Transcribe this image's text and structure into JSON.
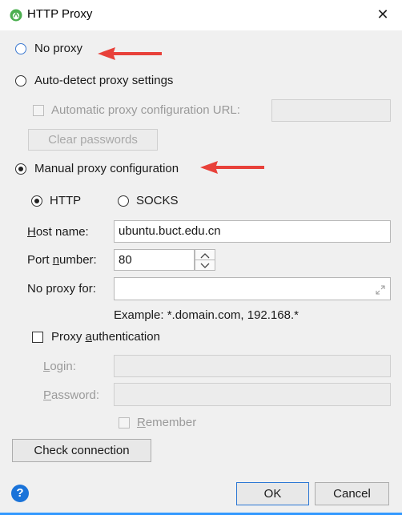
{
  "window": {
    "title": "HTTP Proxy",
    "close_glyph": "✕"
  },
  "proxy_mode": {
    "no_proxy_label": "No proxy",
    "auto_detect_label": "Auto-detect proxy settings",
    "auto_config_url_label": "Automatic proxy configuration URL:",
    "auto_config_url_value": "",
    "clear_passwords_label": "Clear passwords",
    "manual_label": "Manual proxy configuration",
    "selected": "manual"
  },
  "manual": {
    "protocol_http_label": "HTTP",
    "protocol_socks_label": "SOCKS",
    "protocol_selected": "HTTP",
    "host_label_ul": "H",
    "host_label_rest": "ost name:",
    "host_value": "ubuntu.buct.edu.cn",
    "port_label_pre": "Port ",
    "port_label_ul": "n",
    "port_label_post": "umber:",
    "port_value": "80",
    "no_proxy_for_label": "No proxy for:",
    "no_proxy_for_value": "",
    "example_text": "Example: *.domain.com, 192.168.*"
  },
  "auth": {
    "label_pre": "Proxy ",
    "label_ul": "a",
    "label_post": "uthentication",
    "checked": false,
    "login_label_ul": "L",
    "login_label_rest": "ogin:",
    "password_label_ul": "P",
    "password_label_rest": "assword:",
    "remember_label_ul": "R",
    "remember_label_rest": "emember"
  },
  "footer": {
    "check_connection_label": "Check connection",
    "help_glyph": "?",
    "ok_label": "OK",
    "cancel_label": "Cancel"
  },
  "colors": {
    "annotation_arrow": "#e8413a",
    "focus_blue": "#3d7ad1",
    "help_blue": "#1a73d9"
  }
}
